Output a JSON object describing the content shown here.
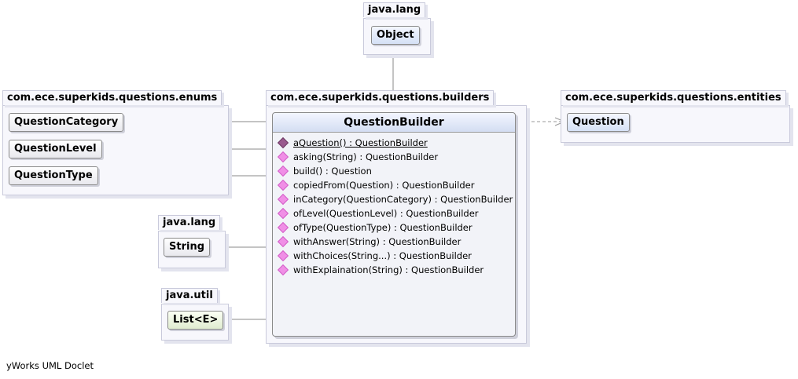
{
  "packages": {
    "java_lang_top": {
      "name": "java.lang",
      "classes": [
        "Object"
      ]
    },
    "enums": {
      "name": "com.ece.superkids.questions.enums",
      "classes": [
        "QuestionCategory",
        "QuestionLevel",
        "QuestionType"
      ]
    },
    "builders": {
      "name": "com.ece.superkids.questions.builders"
    },
    "entities": {
      "name": "com.ece.superkids.questions.entities",
      "classes": [
        "Question"
      ]
    },
    "java_lang_mid": {
      "name": "java.lang",
      "classes": [
        "String"
      ]
    },
    "java_util": {
      "name": "java.util",
      "classes": [
        "List<E>"
      ]
    }
  },
  "main_class": {
    "name": "QuestionBuilder",
    "methods": [
      {
        "label": "aQuestion() : QuestionBuilder",
        "static": true
      },
      {
        "label": "asking(String) : QuestionBuilder",
        "static": false
      },
      {
        "label": "build() : Question",
        "static": false
      },
      {
        "label": "copiedFrom(Question) : QuestionBuilder",
        "static": false
      },
      {
        "label": "inCategory(QuestionCategory) : QuestionBuilder",
        "static": false
      },
      {
        "label": "ofLevel(QuestionLevel) : QuestionBuilder",
        "static": false
      },
      {
        "label": "ofType(QuestionType) : QuestionBuilder",
        "static": false
      },
      {
        "label": "withAnswer(String) : QuestionBuilder",
        "static": false
      },
      {
        "label": "withChoices(String...) : QuestionBuilder",
        "static": false
      },
      {
        "label": "withExplaination(String) : QuestionBuilder",
        "static": false
      }
    ]
  },
  "footer": "yWorks UML Doclet",
  "colors": {
    "package_bg": "#f7f7fc",
    "class_header": "#d3ddf2",
    "method_icon": "#f08fe6",
    "static_icon": "#9a5a8e"
  }
}
